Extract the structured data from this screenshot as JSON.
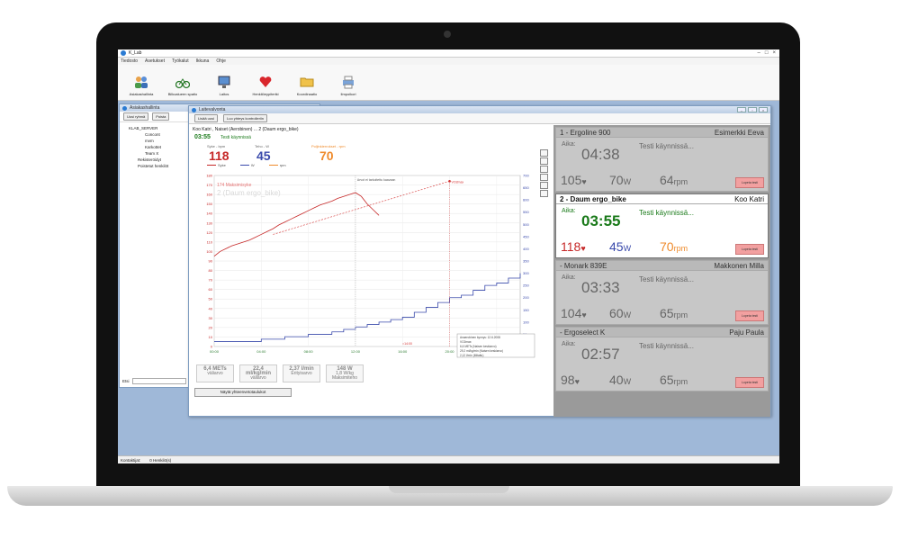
{
  "app": {
    "title": "K_Lab",
    "menu": [
      "Tiedosto",
      "Asetukset",
      "Työkalut",
      "Ikkuna",
      "Ohje"
    ],
    "toolbar": [
      "Asiakashallinta",
      "Bilkoalueen spatio",
      "Laitos",
      "Henkilöeypiteriki",
      "Koordinaatio",
      "Ilmpoikori"
    ]
  },
  "left_pane": {
    "title": "Asiakashallinta",
    "btn_new": "Uusi ryhmä",
    "btn_remove": "Poista",
    "tree": {
      "root": "KLAB_SERVER",
      "children": [
        "Concont",
        "mvm",
        "Karkottet",
        "Team X"
      ],
      "items": [
        "Rekisteröidyt",
        "Poistetut henkilöt"
      ]
    },
    "filter_label": "Etsi"
  },
  "statusbar": {
    "left": "Kontaktijat:",
    "right": "0 Henkilö(s)"
  },
  "child": {
    "title": "Laitevalvonta",
    "btn_add_device": "Lisää uusi",
    "btn_device_settings": "Luo yhteys kontrolleriin",
    "session": {
      "header": "Koo Katri , Naiset (Aerobinen) ... 2 (Daum ergo_bike)",
      "elapsed": "03:55",
      "status": "Testi käynnissä",
      "hr_label": "Syke - bpm",
      "hr": "118",
      "power_label": "Teho - W",
      "power": "45",
      "cad_label": "Poljinkierrokset - rpm",
      "cad": "70",
      "legend": [
        "Syke",
        "W",
        "rpm"
      ]
    },
    "tiles": [
      {
        "value": "6,4 METs",
        "label": "väliarvo"
      },
      {
        "value": "22,4 ml/kg/min",
        "label": "väliarvo"
      },
      {
        "value": "2,37 l/min",
        "label": "Erityisarvo"
      },
      {
        "value": "148 W",
        "sub": "1,8 W/kg",
        "label": "Maksimiteho"
      }
    ],
    "show_btn": "Näytä yhteenvetotaulukot"
  },
  "chart_data": {
    "type": "line",
    "title": "",
    "overlay_text": [
      "174 Maksimisyke",
      "2 (Daum ergo_bike)"
    ],
    "annotation_top": "Arvot ei tarkoitettu kaavaan",
    "xlabel": "",
    "ylabel": "",
    "x_ticks": [
      "00:00",
      "04:00",
      "08:00",
      "12:00",
      "16:00",
      "20:00",
      "24:00"
    ],
    "y_left_ticks": [
      0,
      10,
      20,
      30,
      40,
      50,
      60,
      70,
      80,
      90,
      100,
      110,
      120,
      130,
      140,
      150,
      160,
      170,
      180
    ],
    "y_right_ticks": [
      0,
      50,
      100,
      150,
      200,
      250,
      300,
      350,
      400,
      450,
      500,
      550,
      600,
      650,
      700
    ],
    "ylim_left": [
      0,
      180
    ],
    "ylim_right": [
      0,
      700
    ],
    "series": [
      {
        "name": "Syke",
        "color": "#c62828",
        "x": [
          0,
          0.5,
          1,
          1.5,
          2,
          2.5,
          3,
          3.5,
          4,
          4.5,
          5,
          5.5,
          6,
          6.5,
          7,
          7.5,
          8,
          8.5,
          9,
          9.5,
          10,
          10.5,
          11,
          11.5,
          12,
          12.5,
          13,
          13.5,
          14
        ],
        "values": [
          95,
          100,
          103,
          106,
          108,
          110,
          112,
          115,
          118,
          121,
          124,
          128,
          131,
          134,
          137,
          140,
          143,
          146,
          149,
          151,
          153,
          156,
          158,
          160,
          162,
          158,
          150,
          144,
          138
        ]
      },
      {
        "name": "W",
        "color": "#3949ab",
        "axis": "right",
        "x": [
          0,
          1,
          2,
          3,
          4,
          5,
          6,
          7,
          8,
          9,
          10,
          11,
          12,
          13,
          14,
          15,
          16,
          17,
          18,
          19,
          20,
          21,
          22,
          23,
          24,
          25,
          26
        ],
        "values": [
          20,
          20,
          20,
          20,
          30,
          30,
          40,
          40,
          50,
          50,
          60,
          70,
          80,
          90,
          100,
          110,
          120,
          140,
          160,
          180,
          200,
          210,
          230,
          250,
          260,
          280,
          300
        ]
      }
    ],
    "extrapolation": {
      "from_x": 5,
      "from_y": 118,
      "to_x": 20,
      "to_y": 174,
      "label": "VO2max",
      "vertical_x": 16,
      "vertical_label": "≈14:00"
    },
    "info_box": [
      "Anaerobinen kynnys: 12.6.2008",
      "VO2max:",
      "6,6 METs (Naisen keskiarvo)",
      "29,2 ml/kg/min (Naisen keskiarvo)",
      "2,12 l/min (Mitattu)"
    ]
  },
  "devices": [
    {
      "name": "1 - Ergoline 900",
      "user": "Esimerkki Eeva",
      "aika_label": "Aika:",
      "time": "04:38",
      "status": "Testi käynnissä...",
      "hr": "105",
      "watt": "70",
      "rpm": "64",
      "active": false,
      "stop": "Lopeta testi"
    },
    {
      "name": "2 - Daum ergo_bike",
      "user": "Koo Katri",
      "aika_label": "Aika:",
      "time": "03:55",
      "status": "Testi käynnissä...",
      "hr": "118",
      "watt": "45",
      "rpm": "70",
      "active": true,
      "stop": "Lopeta testi"
    },
    {
      "name": "- Monark 839E",
      "user": "Makkonen Milla",
      "aika_label": "Aika:",
      "time": "03:33",
      "status": "Testi käynnissä...",
      "hr": "104",
      "watt": "60",
      "rpm": "65",
      "active": false,
      "stop": "Lopeta testi"
    },
    {
      "name": "- Ergoselect K",
      "user": "Paju Paula",
      "aika_label": "Aika:",
      "time": "02:57",
      "status": "Testi käynnissä...",
      "hr": "98",
      "watt": "40",
      "rpm": "65",
      "active": false,
      "stop": "Lopeta testi"
    }
  ],
  "colors": {
    "hr": "#c62828",
    "watt": "#3949ab",
    "rpm": "#ef8b2c",
    "active_green": "#1a7a1a",
    "stop_button": "#f2a0a0"
  }
}
